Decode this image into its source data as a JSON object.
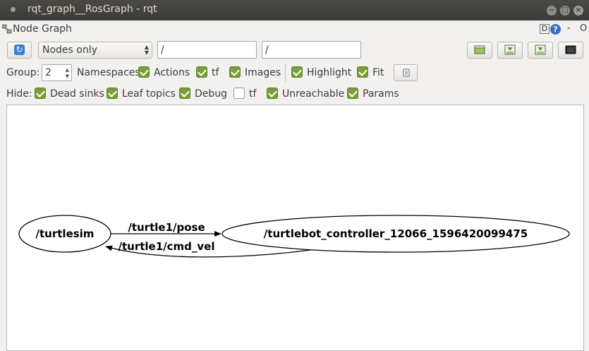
{
  "window": {
    "title": "rqt_graph__RosGraph - rqt",
    "close_glyph": "×",
    "minimize_glyph": "−",
    "maximize_glyph": "□"
  },
  "dock": {
    "title": "Node Graph",
    "d_label": "D",
    "help_label": "?",
    "dash_label": "-",
    "o_label": "O"
  },
  "toolbar": {
    "refresh_glyph": "↻",
    "mode_select": "Nodes only",
    "node_filter": "/",
    "topic_filter": "/"
  },
  "options": {
    "group_label": "Group:",
    "group_value": "2",
    "namespaces_label": "Namespaces",
    "actions_label": "Actions",
    "actions_checked": true,
    "tf_label": "tf",
    "tf_checked": true,
    "images_label": "Images",
    "images_checked": true,
    "highlight_label": "Highlight",
    "highlight_checked": true,
    "fit_label": "Fit",
    "fit_checked": true
  },
  "hide": {
    "label": "Hide:",
    "dead_sinks": "Dead sinks",
    "leaf_topics": "Leaf topics",
    "debug": "Debug",
    "tf": "tf",
    "unreachable": "Unreachable",
    "params": "Params"
  },
  "graph": {
    "nodes": [
      {
        "name": "/turtlesim"
      },
      {
        "name": "/turtlebot_controller_12066_1596420099475"
      }
    ],
    "edges": [
      {
        "label": "/turtle1/pose",
        "from": "/turtlesim",
        "to": "/turtlebot_controller_12066_1596420099475"
      },
      {
        "label": "/turtle1/cmd_vel",
        "from": "/turtlebot_controller_12066_1596420099475",
        "to": "/turtlesim"
      }
    ]
  },
  "icons": {
    "refresh": "refresh-icon",
    "open": "open-file-icon",
    "save_dot": "save-dot-icon",
    "save_svg": "save-image-icon",
    "screenshot": "screen-icon"
  }
}
